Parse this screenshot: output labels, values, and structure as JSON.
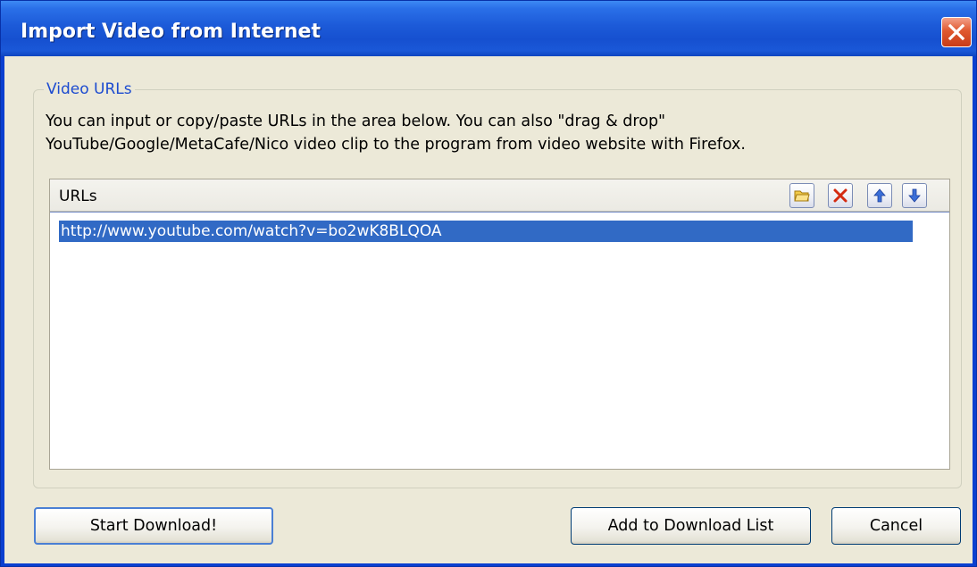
{
  "window": {
    "title": "Import Video from Internet",
    "close_icon": "close-icon"
  },
  "group": {
    "legend": "Video URLs",
    "description_line1": "You can input or copy/paste URLs in the area below. You can also \"drag & drop\"",
    "description_line2": "YouTube/Google/MetaCafe/Nico video clip to the program from video website with Firefox."
  },
  "urls": {
    "header_label": "URLs",
    "toolbar_icons": [
      "open-folder-icon",
      "delete-icon",
      "move-up-icon",
      "move-down-icon"
    ],
    "items": [
      {
        "url": "http://www.youtube.com/watch?v=bo2wK8BLQOA",
        "selected": true
      }
    ]
  },
  "buttons": {
    "start_download": "Start Download!",
    "add_to_list": "Add to Download List",
    "cancel": "Cancel"
  },
  "colors": {
    "title_bar": "#1c5ad8",
    "selection": "#316ac5",
    "legend_text": "#1c4bd0",
    "dialog_background": "#ece9d8"
  }
}
